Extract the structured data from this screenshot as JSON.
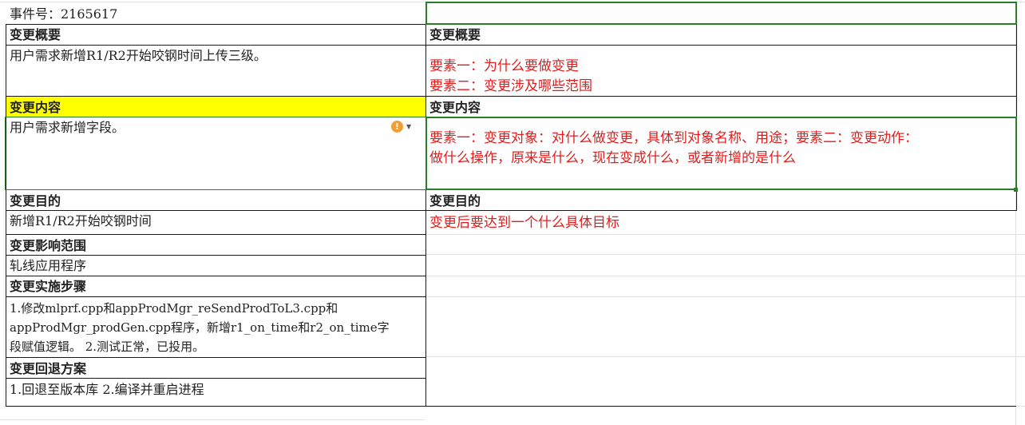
{
  "rows": {
    "event": {
      "left": "事件号：2165617",
      "right": ""
    },
    "summary_header": {
      "left": "变更概要",
      "right": "变更概要"
    },
    "summary_content": {
      "left": "用户需求新增R1/R2开始咬钢时间上传三级。",
      "right_line1": "要素一：为什么要做变更",
      "right_line2": "要素二：变更涉及哪些范围"
    },
    "content_header": {
      "left": "变更内容",
      "right": "变更内容"
    },
    "content_body": {
      "left": "用户需求新增字段。",
      "right_line1": "要素一：变更对象：对什么做变更，具体到对象名称、用途；要素二：变更动作：",
      "right_line2": "做什么操作，原来是什么，现在变成什么，或者新增的是什么"
    },
    "purpose_header": {
      "left": "变更目的",
      "right": "变更目的"
    },
    "purpose_body": {
      "left": "新增R1/R2开始咬钢时间",
      "right": "变更后要达到一个什么具体目标"
    },
    "impact_header": {
      "left": "变更影响范围",
      "right": ""
    },
    "impact_body": {
      "left": "轧线应用程序",
      "right": ""
    },
    "steps_header": {
      "left": "变更实施步骤",
      "right": ""
    },
    "steps_body": {
      "left_line1": "1.修改mlprf.cpp和appProdMgr_reSendProdToL3.cpp和",
      "left_line2": "appProdMgr_prodGen.cpp程序，新增r1_on_time和r2_on_time字",
      "left_line3": "段赋值逻辑。 2.测试正常，已投用。",
      "right": ""
    },
    "rollback_header": {
      "left": "变更回退方案",
      "right": ""
    },
    "rollback_body": {
      "left": "1.回退至版本库 2.编译并重启进程",
      "right": ""
    }
  },
  "warning_icon": {
    "icon": "exclamation-icon",
    "color": "#f0a030"
  },
  "colors": {
    "highlight": "#ffff00",
    "selection": "#2a7e2a",
    "note_text": "#e21d1d"
  }
}
